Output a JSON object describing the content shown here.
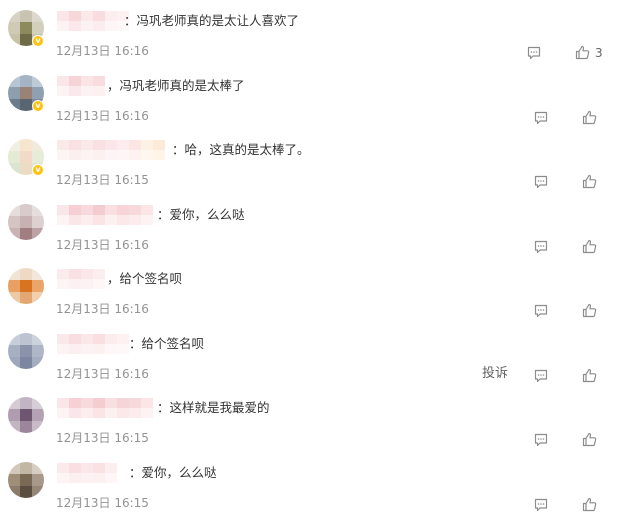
{
  "comments": [
    {
      "text": "：冯巩老师真的是太让人喜欢了",
      "time": "12月13日 16:16",
      "likes": "3",
      "verified": true
    },
    {
      "text": "，冯巩老师真的是太棒了",
      "time": "12月13日 16:16",
      "likes": "",
      "verified": true
    },
    {
      "text": "：哈，这真的是太棒了。",
      "time": "12月13日 16:15",
      "likes": "",
      "verified": true
    },
    {
      "text": "：爱你，么么哒",
      "time": "12月13日 16:16",
      "likes": "",
      "verified": false
    },
    {
      "text": "，给个签名呗",
      "time": "12月13日 16:16",
      "likes": "",
      "verified": false
    },
    {
      "text": "：给个签名呗",
      "time": "12月13日 16:16",
      "likes": "",
      "verified": false,
      "report": "投诉"
    },
    {
      "text": "：这样就是我最爱的",
      "time": "12月13日 16:15",
      "likes": "",
      "verified": false
    },
    {
      "text": "：爱你，么么哒",
      "time": "12月13日 16:15",
      "likes": "",
      "verified": false
    }
  ],
  "colors": {
    "text": "#333333",
    "time": "#939393",
    "icon": "#8c8c8c",
    "verified_badge": "#ffc20e"
  },
  "icons": {
    "reply": "comment-bubble-icon",
    "like": "thumbs-up-icon",
    "verified": "verified-badge-icon"
  }
}
